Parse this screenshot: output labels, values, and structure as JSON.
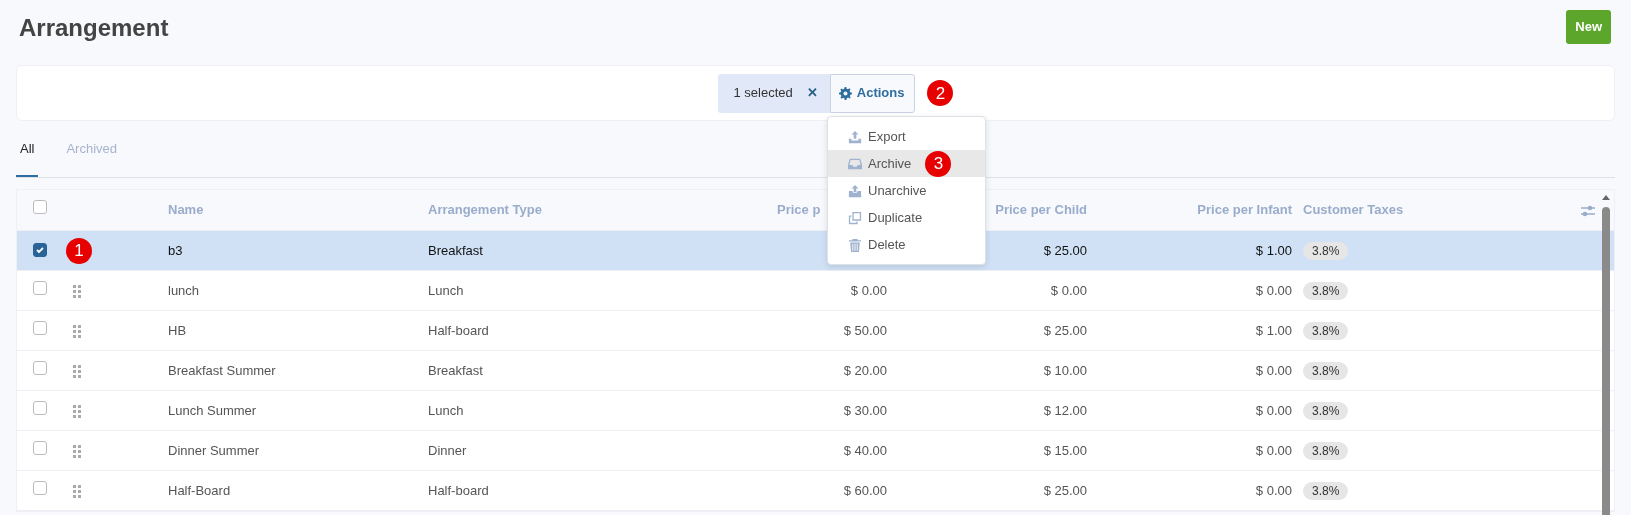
{
  "title": "Arrangement",
  "new_button": "New",
  "selection": {
    "label": "1 selected",
    "clear": "✕"
  },
  "actions": {
    "label": "Actions",
    "callout": "2",
    "expanded": true,
    "menu": [
      {
        "kind": "export",
        "label": "Export",
        "selected": false
      },
      {
        "kind": "archive",
        "label": "Archive",
        "selected": true,
        "callout": "3"
      },
      {
        "kind": "unarchive",
        "label": "Unarchive",
        "selected": false
      },
      {
        "kind": "duplicate",
        "label": "Duplicate",
        "selected": false
      },
      {
        "kind": "delete",
        "label": "Delete",
        "selected": false
      }
    ]
  },
  "tabs": [
    {
      "label": "All",
      "selected": true
    },
    {
      "label": "Archived",
      "selected": false
    }
  ],
  "table": {
    "select_all_checked": false,
    "columns": [
      {
        "label": "Name",
        "kind": "text"
      },
      {
        "label": "Arrangement Type",
        "kind": "text"
      },
      {
        "label": "Price p",
        "kind": "price",
        "covered": true
      },
      {
        "label": "Price per Child",
        "kind": "price"
      },
      {
        "label": "Price per Infant",
        "kind": "price"
      },
      {
        "label": "Customer Taxes",
        "kind": "taxes"
      }
    ],
    "rows": [
      {
        "checked": true,
        "selected": true,
        "callout": "1",
        "cells": [
          "b3",
          "Breakfast",
          null,
          "$ 25.00",
          "$ 1.00",
          "3.8%"
        ]
      },
      {
        "checked": false,
        "selected": false,
        "cells": [
          "lunch",
          "Lunch",
          "$ 0.00",
          "$ 0.00",
          "$ 0.00",
          "3.8%"
        ]
      },
      {
        "checked": false,
        "selected": false,
        "cells": [
          "HB",
          "Half-board",
          "$ 50.00",
          "$ 25.00",
          "$ 1.00",
          "3.8%"
        ]
      },
      {
        "checked": false,
        "selected": false,
        "cells": [
          "Breakfast Summer",
          "Breakfast",
          "$ 20.00",
          "$ 10.00",
          "$ 0.00",
          "3.8%"
        ]
      },
      {
        "checked": false,
        "selected": false,
        "cells": [
          "Lunch Summer",
          "Lunch",
          "$ 30.00",
          "$ 12.00",
          "$ 0.00",
          "3.8%"
        ]
      },
      {
        "checked": false,
        "selected": false,
        "cells": [
          "Dinner Summer",
          "Dinner",
          "$ 40.00",
          "$ 15.00",
          "$ 0.00",
          "3.8%"
        ]
      },
      {
        "checked": false,
        "selected": false,
        "cells": [
          "Half-Board",
          "Half-board",
          "$ 60.00",
          "$ 25.00",
          "$ 0.00",
          "3.8%"
        ]
      }
    ]
  }
}
